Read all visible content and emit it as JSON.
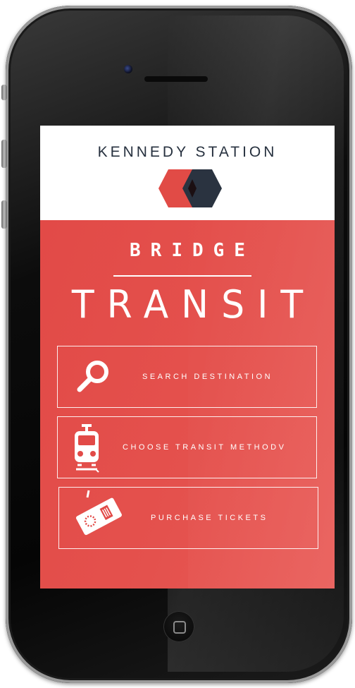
{
  "app": {
    "station_name": "KENNEDY STATION",
    "brand_line1": "BRIDGE",
    "brand_line2": "TRANSIT"
  },
  "menu": [
    {
      "label": "SEARCH DESTINATION",
      "icon": "magnifier-icon"
    },
    {
      "label": "CHOOSE TRANSIT METHODV",
      "icon": "train-icon"
    },
    {
      "label": "PURCHASE TICKETS",
      "icon": "ticket-icon"
    }
  ],
  "colors": {
    "accent": "#e24a47",
    "header_text": "#27313f",
    "logo_red": "#e14b46",
    "logo_dark": "#2a3340",
    "phone_body": "#0c0c0c"
  }
}
